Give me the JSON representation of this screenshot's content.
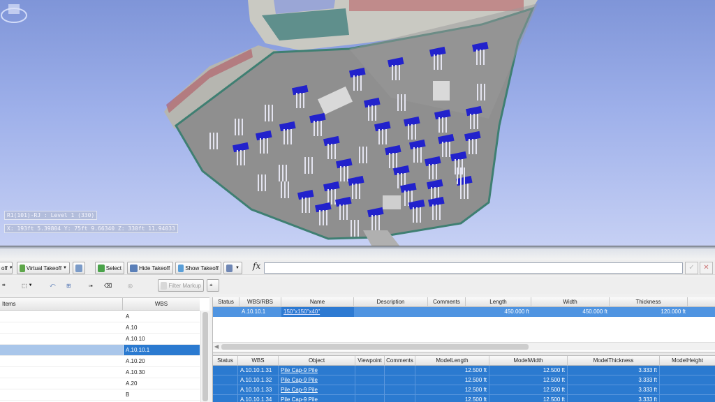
{
  "viewport": {
    "level_label": "R1(101)-RJ : Level 1 (330)",
    "coordinate_readout": "X: 193ft 5.39804  Y: 75ft 9.66340  Z: 330ft 11.94033"
  },
  "toolbar": {
    "takeoff_partial": "off",
    "virtual_takeoff": "Virtual Takeoff",
    "select": "Select",
    "hide_takeoff": "Hide Takeoff",
    "show_takeoff": "Show Takeoff",
    "filter_markup": "Filter Markup",
    "formula_symbol": "fx",
    "formula_value": ""
  },
  "tree": {
    "columns": [
      "Items",
      "WBS"
    ],
    "rows": [
      {
        "wbs": "A",
        "selected": false
      },
      {
        "wbs": "A.10",
        "selected": false
      },
      {
        "wbs": "A.10.10",
        "selected": false
      },
      {
        "wbs": "A.10.10.1",
        "selected": true
      },
      {
        "wbs": "A.10.20",
        "selected": false
      },
      {
        "wbs": "A.10.30",
        "selected": false
      },
      {
        "wbs": "A.20",
        "selected": false
      },
      {
        "wbs": "B",
        "selected": false
      }
    ]
  },
  "items_grid": {
    "columns": [
      "Status",
      "WBS/RBS",
      "Name",
      "Description",
      "Comments",
      "Length",
      "Width",
      "Thickness"
    ],
    "rows": [
      {
        "status": "",
        "wbs": "A.10.10.1",
        "name": "150\"x150\"x40\"",
        "description": "",
        "comments": "",
        "length": "450.000 ft",
        "width": "450.000 ft",
        "thickness": "120.000 ft"
      }
    ]
  },
  "objects_grid": {
    "columns": [
      "Status",
      "WBS",
      "Object",
      "Viewpoint",
      "Comments",
      "ModelLength",
      "ModelWidth",
      "ModelThickness",
      "ModelHeight"
    ],
    "rows": [
      {
        "wbs": "A.10.10.1.31",
        "object": "Pile Cap-9 Pile",
        "length": "12.500 ft",
        "width": "12.500 ft",
        "thickness": "3.333 ft"
      },
      {
        "wbs": "A.10.10.1.32",
        "object": "Pile Cap-9 Pile",
        "length": "12.500 ft",
        "width": "12.500 ft",
        "thickness": "3.333 ft"
      },
      {
        "wbs": "A.10.10.1.33",
        "object": "Pile Cap-9 Pile",
        "length": "12.500 ft",
        "width": "12.500 ft",
        "thickness": "3.333 ft"
      },
      {
        "wbs": "A.10.10.1.34",
        "object": "Pile Cap-9 Pile",
        "length": "12.500 ft",
        "width": "12.500 ft",
        "thickness": "3.333 ft"
      }
    ]
  },
  "colors": {
    "selection": "#2b7ad0",
    "pile_cap": "#2222cc",
    "slab": "#8c8c8c"
  }
}
